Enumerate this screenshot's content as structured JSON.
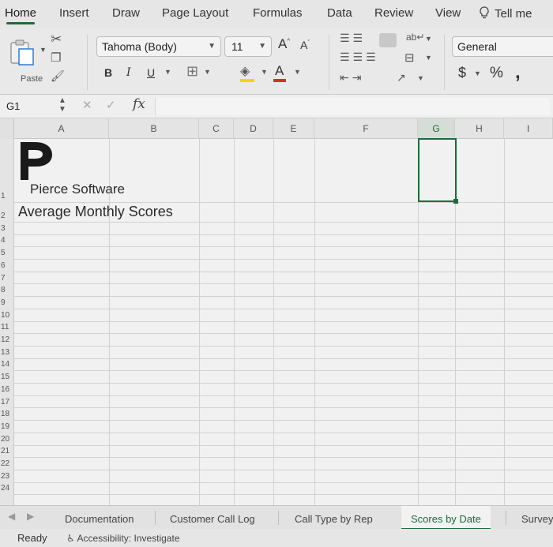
{
  "ribbon_tabs": [
    "Home",
    "Insert",
    "Draw",
    "Page Layout",
    "Formulas",
    "Data",
    "Review",
    "View"
  ],
  "tell_me": "Tell me",
  "clipboard": {
    "paste_label": "Paste"
  },
  "font": {
    "name": "Tahoma (Body)",
    "size": "11",
    "grow": "A",
    "shrink": "A",
    "bold": "B",
    "italic": "I",
    "underline": "U",
    "font_color_letter": "A"
  },
  "number": {
    "format": "General",
    "currency": "$",
    "percent": "%",
    "comma": ","
  },
  "formula_bar": {
    "name_box": "G1",
    "fx": "fx",
    "value": ""
  },
  "columns": [
    "A",
    "B",
    "C",
    "D",
    "E",
    "F",
    "G",
    "H",
    "I"
  ],
  "selected_column": "G",
  "rows": [
    "1",
    "2",
    "3",
    "4",
    "5",
    "6",
    "7",
    "8",
    "9",
    "10",
    "11",
    "12",
    "13",
    "14",
    "15",
    "16",
    "17",
    "18",
    "19",
    "20",
    "21",
    "22",
    "23",
    "24"
  ],
  "cells": {
    "A1": "Pierce Software",
    "A2": "Average Monthly Scores"
  },
  "sheet_tabs": [
    "Documentation",
    "Customer Call Log",
    "Call Type by Rep",
    "Scores by Date",
    "Survey"
  ],
  "active_sheet": "Scores by Date",
  "status": {
    "ready": "Ready",
    "accessibility": "Accessibility: Investigate"
  },
  "colors": {
    "accent": "#1e6b3a",
    "font_color_bar": "#d32f2f",
    "fill_color_bar": "#f2d600"
  }
}
